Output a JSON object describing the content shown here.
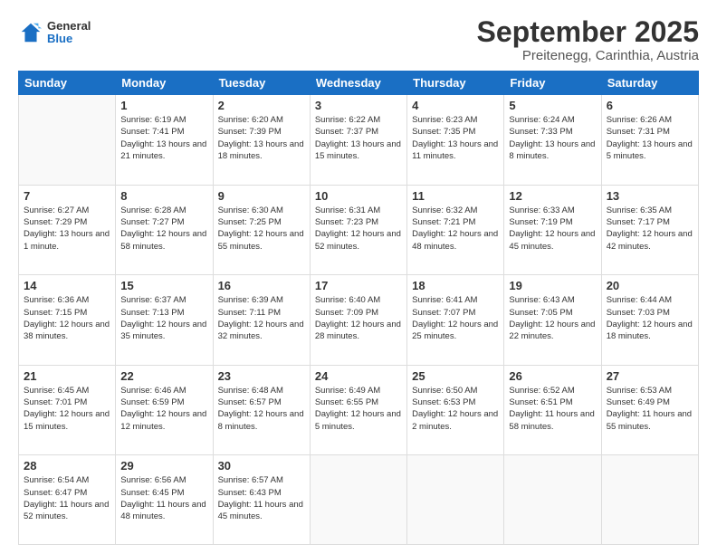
{
  "header": {
    "logo": {
      "general": "General",
      "blue": "Blue"
    },
    "month_title": "September 2025",
    "location": "Preitenegg, Carinthia, Austria"
  },
  "weekdays": [
    "Sunday",
    "Monday",
    "Tuesday",
    "Wednesday",
    "Thursday",
    "Friday",
    "Saturday"
  ],
  "weeks": [
    [
      {
        "day": "",
        "info": ""
      },
      {
        "day": "1",
        "info": "Sunrise: 6:19 AM\nSunset: 7:41 PM\nDaylight: 13 hours\nand 21 minutes."
      },
      {
        "day": "2",
        "info": "Sunrise: 6:20 AM\nSunset: 7:39 PM\nDaylight: 13 hours\nand 18 minutes."
      },
      {
        "day": "3",
        "info": "Sunrise: 6:22 AM\nSunset: 7:37 PM\nDaylight: 13 hours\nand 15 minutes."
      },
      {
        "day": "4",
        "info": "Sunrise: 6:23 AM\nSunset: 7:35 PM\nDaylight: 13 hours\nand 11 minutes."
      },
      {
        "day": "5",
        "info": "Sunrise: 6:24 AM\nSunset: 7:33 PM\nDaylight: 13 hours\nand 8 minutes."
      },
      {
        "day": "6",
        "info": "Sunrise: 6:26 AM\nSunset: 7:31 PM\nDaylight: 13 hours\nand 5 minutes."
      }
    ],
    [
      {
        "day": "7",
        "info": "Sunrise: 6:27 AM\nSunset: 7:29 PM\nDaylight: 13 hours\nand 1 minute."
      },
      {
        "day": "8",
        "info": "Sunrise: 6:28 AM\nSunset: 7:27 PM\nDaylight: 12 hours\nand 58 minutes."
      },
      {
        "day": "9",
        "info": "Sunrise: 6:30 AM\nSunset: 7:25 PM\nDaylight: 12 hours\nand 55 minutes."
      },
      {
        "day": "10",
        "info": "Sunrise: 6:31 AM\nSunset: 7:23 PM\nDaylight: 12 hours\nand 52 minutes."
      },
      {
        "day": "11",
        "info": "Sunrise: 6:32 AM\nSunset: 7:21 PM\nDaylight: 12 hours\nand 48 minutes."
      },
      {
        "day": "12",
        "info": "Sunrise: 6:33 AM\nSunset: 7:19 PM\nDaylight: 12 hours\nand 45 minutes."
      },
      {
        "day": "13",
        "info": "Sunrise: 6:35 AM\nSunset: 7:17 PM\nDaylight: 12 hours\nand 42 minutes."
      }
    ],
    [
      {
        "day": "14",
        "info": "Sunrise: 6:36 AM\nSunset: 7:15 PM\nDaylight: 12 hours\nand 38 minutes."
      },
      {
        "day": "15",
        "info": "Sunrise: 6:37 AM\nSunset: 7:13 PM\nDaylight: 12 hours\nand 35 minutes."
      },
      {
        "day": "16",
        "info": "Sunrise: 6:39 AM\nSunset: 7:11 PM\nDaylight: 12 hours\nand 32 minutes."
      },
      {
        "day": "17",
        "info": "Sunrise: 6:40 AM\nSunset: 7:09 PM\nDaylight: 12 hours\nand 28 minutes."
      },
      {
        "day": "18",
        "info": "Sunrise: 6:41 AM\nSunset: 7:07 PM\nDaylight: 12 hours\nand 25 minutes."
      },
      {
        "day": "19",
        "info": "Sunrise: 6:43 AM\nSunset: 7:05 PM\nDaylight: 12 hours\nand 22 minutes."
      },
      {
        "day": "20",
        "info": "Sunrise: 6:44 AM\nSunset: 7:03 PM\nDaylight: 12 hours\nand 18 minutes."
      }
    ],
    [
      {
        "day": "21",
        "info": "Sunrise: 6:45 AM\nSunset: 7:01 PM\nDaylight: 12 hours\nand 15 minutes."
      },
      {
        "day": "22",
        "info": "Sunrise: 6:46 AM\nSunset: 6:59 PM\nDaylight: 12 hours\nand 12 minutes."
      },
      {
        "day": "23",
        "info": "Sunrise: 6:48 AM\nSunset: 6:57 PM\nDaylight: 12 hours\nand 8 minutes."
      },
      {
        "day": "24",
        "info": "Sunrise: 6:49 AM\nSunset: 6:55 PM\nDaylight: 12 hours\nand 5 minutes."
      },
      {
        "day": "25",
        "info": "Sunrise: 6:50 AM\nSunset: 6:53 PM\nDaylight: 12 hours\nand 2 minutes."
      },
      {
        "day": "26",
        "info": "Sunrise: 6:52 AM\nSunset: 6:51 PM\nDaylight: 11 hours\nand 58 minutes."
      },
      {
        "day": "27",
        "info": "Sunrise: 6:53 AM\nSunset: 6:49 PM\nDaylight: 11 hours\nand 55 minutes."
      }
    ],
    [
      {
        "day": "28",
        "info": "Sunrise: 6:54 AM\nSunset: 6:47 PM\nDaylight: 11 hours\nand 52 minutes."
      },
      {
        "day": "29",
        "info": "Sunrise: 6:56 AM\nSunset: 6:45 PM\nDaylight: 11 hours\nand 48 minutes."
      },
      {
        "day": "30",
        "info": "Sunrise: 6:57 AM\nSunset: 6:43 PM\nDaylight: 11 hours\nand 45 minutes."
      },
      {
        "day": "",
        "info": ""
      },
      {
        "day": "",
        "info": ""
      },
      {
        "day": "",
        "info": ""
      },
      {
        "day": "",
        "info": ""
      }
    ]
  ]
}
